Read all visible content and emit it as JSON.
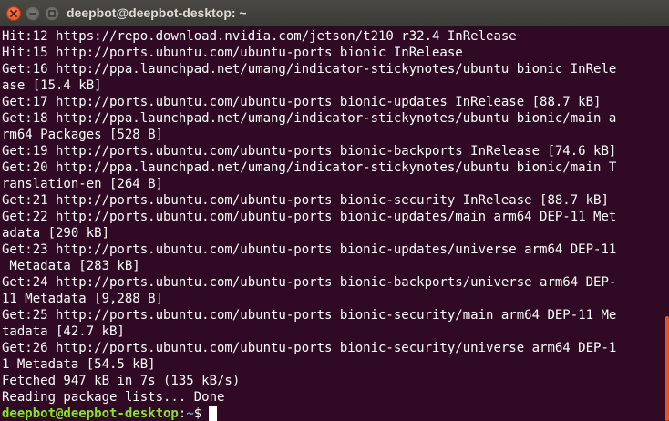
{
  "window": {
    "title": "deepbot@deepbot-desktop: ~",
    "buttons": {
      "close": "close-icon",
      "minimize": "minimize-icon",
      "maximize": "maximize-icon"
    }
  },
  "terminal": {
    "lines": [
      "Hit:12 https://repo.download.nvidia.com/jetson/t210 r32.4 InRelease",
      "Hit:15 http://ports.ubuntu.com/ubuntu-ports bionic InRelease",
      "Get:16 http://ppa.launchpad.net/umang/indicator-stickynotes/ubuntu bionic InRele",
      "ase [15.4 kB]",
      "Get:17 http://ports.ubuntu.com/ubuntu-ports bionic-updates InRelease [88.7 kB]",
      "Get:18 http://ppa.launchpad.net/umang/indicator-stickynotes/ubuntu bionic/main a",
      "rm64 Packages [528 B]",
      "Get:19 http://ports.ubuntu.com/ubuntu-ports bionic-backports InRelease [74.6 kB]",
      "Get:20 http://ppa.launchpad.net/umang/indicator-stickynotes/ubuntu bionic/main T",
      "ranslation-en [264 B]",
      "Get:21 http://ports.ubuntu.com/ubuntu-ports bionic-security InRelease [88.7 kB]",
      "Get:22 http://ports.ubuntu.com/ubuntu-ports bionic-updates/main arm64 DEP-11 Met",
      "adata [290 kB]",
      "Get:23 http://ports.ubuntu.com/ubuntu-ports bionic-updates/universe arm64 DEP-11",
      " Metadata [283 kB]",
      "Get:24 http://ports.ubuntu.com/ubuntu-ports bionic-backports/universe arm64 DEP-",
      "11 Metadata [9,288 B]",
      "Get:25 http://ports.ubuntu.com/ubuntu-ports bionic-security/main arm64 DEP-11 Me",
      "tadata [42.7 kB]",
      "Get:26 http://ports.ubuntu.com/ubuntu-ports bionic-security/universe arm64 DEP-1",
      "1 Metadata [54.5 kB]",
      "Fetched 947 kB in 7s (135 kB/s)",
      "Reading package lists... Done"
    ],
    "prompt": {
      "user_host": "deepbot@deepbot-desktop",
      "colon": ":",
      "path": "~",
      "symbol": "$"
    }
  },
  "colors": {
    "background": "#300a24",
    "prompt_user": "#8ae234",
    "prompt_path": "#729fcf",
    "scrollbar_thumb": "#e95420",
    "close_button": "#df4a16"
  }
}
